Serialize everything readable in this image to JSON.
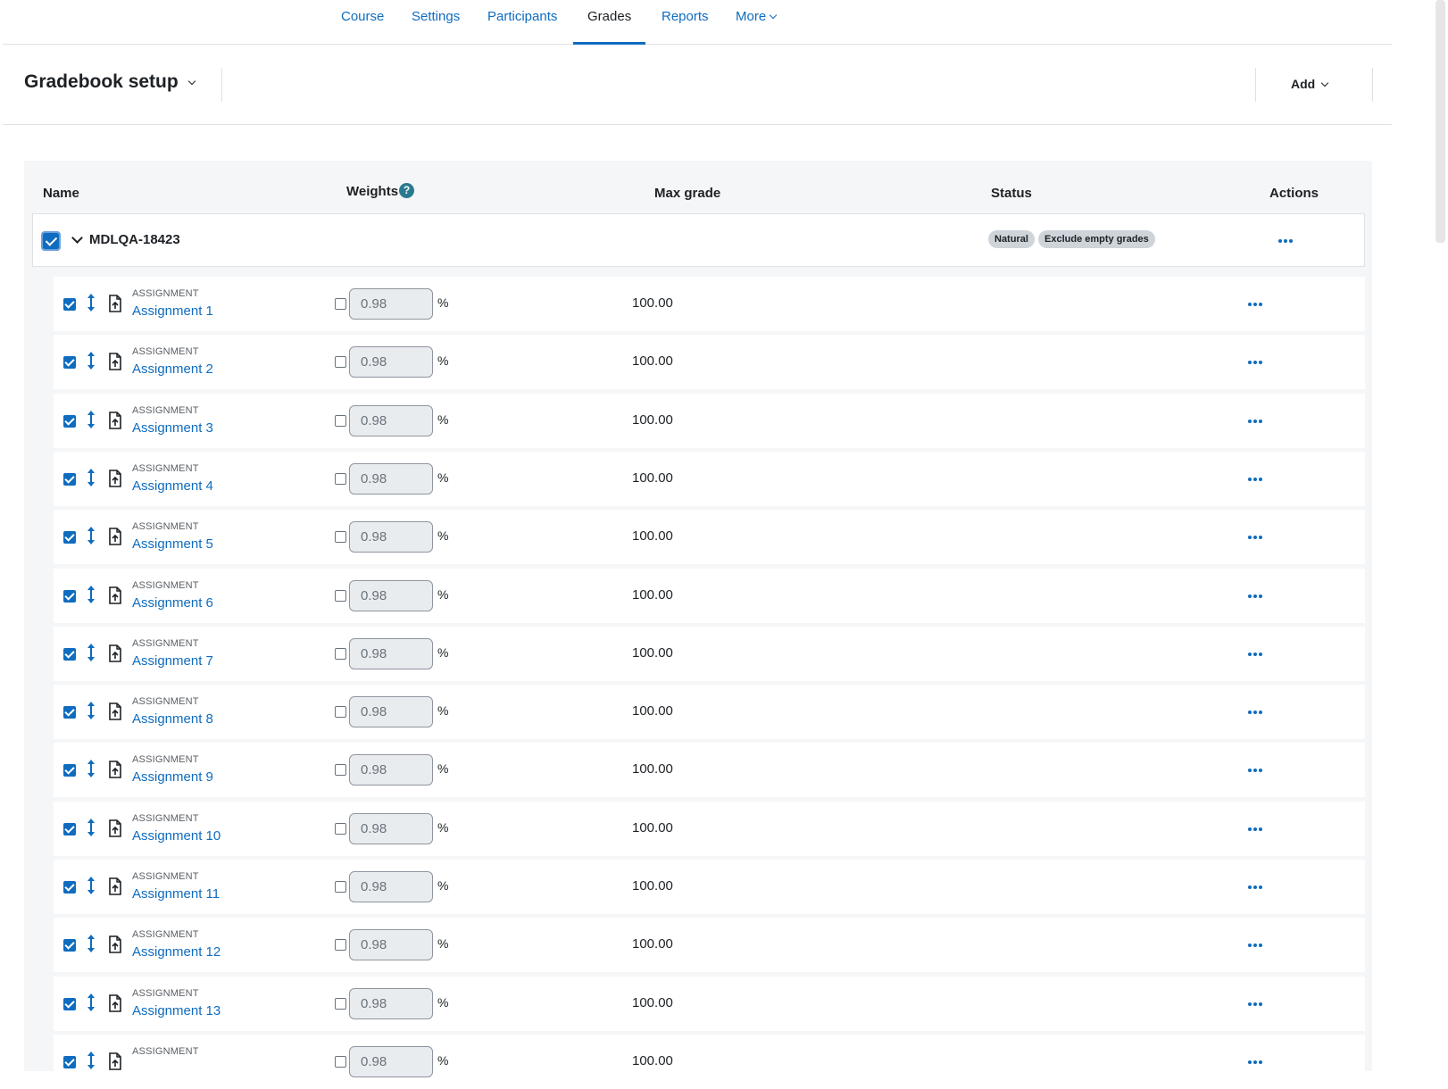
{
  "nav": {
    "tabs": [
      {
        "label": "Course",
        "active": false
      },
      {
        "label": "Settings",
        "active": false
      },
      {
        "label": "Participants",
        "active": false
      },
      {
        "label": "Grades",
        "active": true
      },
      {
        "label": "Reports",
        "active": false
      },
      {
        "label": "More",
        "active": false,
        "has_dropdown": true
      }
    ]
  },
  "header": {
    "title": "Gradebook setup",
    "add_label": "Add"
  },
  "table": {
    "columns": {
      "name": "Name",
      "weights": "Weights",
      "weights_help": "?",
      "max_grade": "Max grade",
      "status": "Status",
      "actions": "Actions"
    },
    "category": {
      "name": "MDLQA-18423",
      "checked": true,
      "expanded": true,
      "badges": [
        "Natural",
        "Exclude empty grades"
      ]
    },
    "items": [
      {
        "type": "ASSIGNMENT",
        "name": "Assignment 1",
        "weight": "0.98",
        "pct": "%",
        "max_grade": "100.00"
      },
      {
        "type": "ASSIGNMENT",
        "name": "Assignment 2",
        "weight": "0.98",
        "pct": "%",
        "max_grade": "100.00"
      },
      {
        "type": "ASSIGNMENT",
        "name": "Assignment 3",
        "weight": "0.98",
        "pct": "%",
        "max_grade": "100.00"
      },
      {
        "type": "ASSIGNMENT",
        "name": "Assignment 4",
        "weight": "0.98",
        "pct": "%",
        "max_grade": "100.00"
      },
      {
        "type": "ASSIGNMENT",
        "name": "Assignment 5",
        "weight": "0.98",
        "pct": "%",
        "max_grade": "100.00"
      },
      {
        "type": "ASSIGNMENT",
        "name": "Assignment 6",
        "weight": "0.98",
        "pct": "%",
        "max_grade": "100.00"
      },
      {
        "type": "ASSIGNMENT",
        "name": "Assignment 7",
        "weight": "0.98",
        "pct": "%",
        "max_grade": "100.00"
      },
      {
        "type": "ASSIGNMENT",
        "name": "Assignment 8",
        "weight": "0.98",
        "pct": "%",
        "max_grade": "100.00"
      },
      {
        "type": "ASSIGNMENT",
        "name": "Assignment 9",
        "weight": "0.98",
        "pct": "%",
        "max_grade": "100.00"
      },
      {
        "type": "ASSIGNMENT",
        "name": "Assignment 10",
        "weight": "0.98",
        "pct": "%",
        "max_grade": "100.00"
      },
      {
        "type": "ASSIGNMENT",
        "name": "Assignment 11",
        "weight": "0.98",
        "pct": "%",
        "max_grade": "100.00"
      },
      {
        "type": "ASSIGNMENT",
        "name": "Assignment 12",
        "weight": "0.98",
        "pct": "%",
        "max_grade": "100.00"
      },
      {
        "type": "ASSIGNMENT",
        "name": "Assignment 13",
        "weight": "0.98",
        "pct": "%",
        "max_grade": "100.00"
      },
      {
        "type": "ASSIGNMENT",
        "name": "",
        "weight": "0.98",
        "pct": "%",
        "max_grade": "100.00"
      }
    ]
  },
  "colors": {
    "link": "#0f6cbf",
    "text": "#1d2125",
    "badge_bg": "#ced4da",
    "table_bg": "#f5f6f8",
    "help_icon": "#2a7a8f"
  },
  "icons": {
    "more_chevron": "chevron-down-icon",
    "help": "question-circle-icon",
    "move": "move-arrows-icon",
    "assignment": "assignment-upload-icon",
    "actions": "ellipsis-icon"
  }
}
